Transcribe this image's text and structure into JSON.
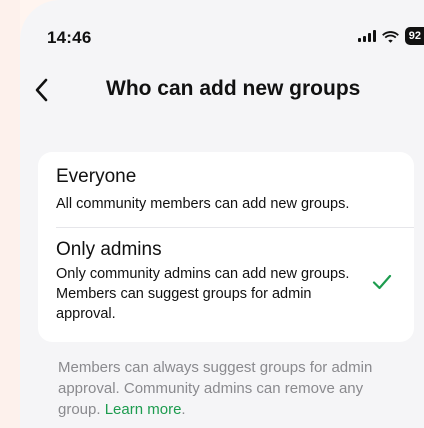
{
  "status_bar": {
    "time": "14:46",
    "battery": "92"
  },
  "nav": {
    "title": "Who can add new groups"
  },
  "options": [
    {
      "title": "Everyone",
      "description": "All community members can add new groups.",
      "selected": false
    },
    {
      "title": "Only admins",
      "description": "Only community admins can add new groups. Members can suggest groups for admin approval.",
      "selected": true
    }
  ],
  "footer": {
    "text": "Members can always suggest groups for admin approval. Community admins can remove any group. ",
    "link": "Learn more",
    "link_suffix": "."
  },
  "colors": {
    "accent": "#1d9c4f",
    "background": "#f5f5f7",
    "card": "#ffffff",
    "secondary_text": "#8a8a8e"
  },
  "icons": {
    "back": "chevron-left-icon",
    "check": "checkmark-icon",
    "signal": "cellular-signal-icon",
    "wifi": "wifi-icon",
    "battery": "battery-icon"
  }
}
